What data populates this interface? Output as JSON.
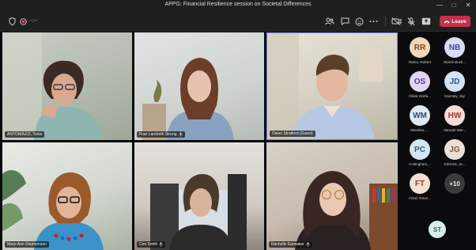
{
  "window": {
    "title": "APPG: Financial Resilience session on Societal Differences"
  },
  "toolbar": {
    "timer": "-:--",
    "leave_label": "Leave",
    "colors": {
      "leave": "#c4314b",
      "bar": "#1f1f1f"
    }
  },
  "tiles": [
    {
      "name": "ANTONIAZZI, Tonia"
    },
    {
      "name": "Fran Landreth Strong"
    },
    {
      "name": "Owen Stratford (Guest)"
    },
    {
      "name": "Mary-Ann Stephenson"
    },
    {
      "name": "Cen Smith"
    },
    {
      "name": "Rachelle Earwaker"
    }
  ],
  "roster": [
    {
      "initials": "RR",
      "name": "Ramo, Robert",
      "bg": "#f2d7b6",
      "fg": "#7a4a1e"
    },
    {
      "initials": "NB",
      "name": "Niamh Buck...",
      "bg": "#d8dcf5",
      "fg": "#3e4a9c"
    },
    {
      "initials": "OS",
      "name": "Olivia Szefa...",
      "bg": "#e0d6f1",
      "fg": "#5a3c8f"
    },
    {
      "initials": "JD",
      "name": "Doesley, Jay",
      "bg": "#d3e2f4",
      "fg": "#2c5a8f"
    },
    {
      "initials": "WM",
      "name": "Mereline, ...",
      "bg": "#dfe7f3",
      "fg": "#2d4e78"
    },
    {
      "initials": "HW",
      "name": "Hannah Wer...",
      "bg": "#f5dcd6",
      "fg": "#9a3a2c"
    },
    {
      "initials": "PC",
      "name": "Cottingham,...",
      "bg": "#d5e6f1",
      "fg": "#2a6389"
    },
    {
      "initials": "JG",
      "name": "Gilchrist, Je...",
      "bg": "#ebe0d7",
      "fg": "#7a5a41"
    },
    {
      "initials": "FT",
      "name": "Fionn Trave...",
      "bg": "#f3e0d3",
      "fg": "#8a4a28"
    },
    {
      "initials": "+10",
      "name": "",
      "bg": "#3a3a3a",
      "fg": "#e6e6e6"
    },
    {
      "initials": "ST",
      "name": "",
      "bg": "#d9ecec",
      "fg": "#2b6b6b"
    }
  ]
}
